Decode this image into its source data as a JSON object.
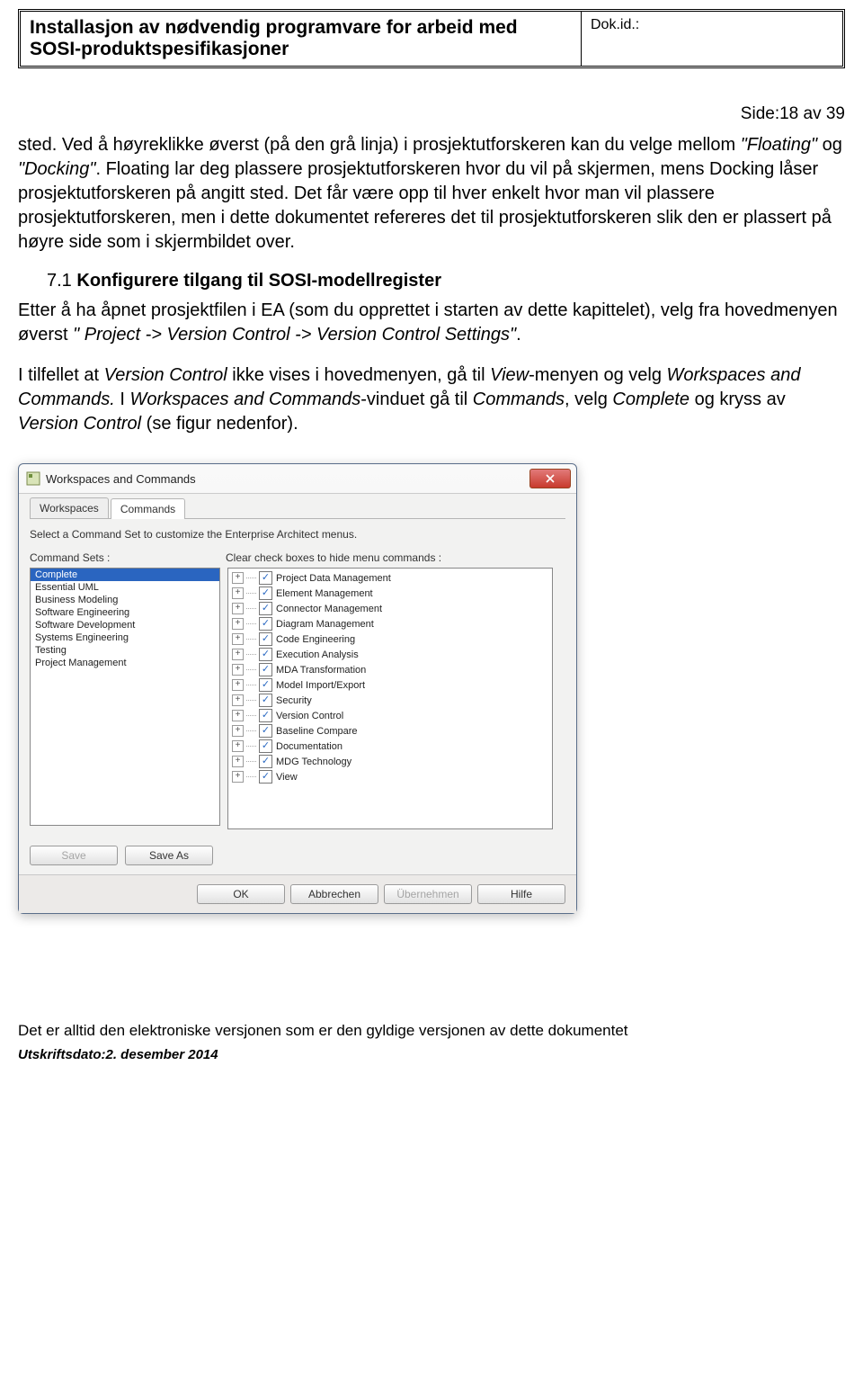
{
  "header": {
    "title": "Installasjon av nødvendig programvare for arbeid med SOSI-produktspesifikasjoner",
    "dokid_label": "Dok.id.:"
  },
  "page_number": "Side:18 av 39",
  "para1_pre": "sted. Ved å høyreklikke øverst (på den grå linja) i prosjektutforskeren kan du velge mellom ",
  "para1_q1": "\"Floating\"",
  "para1_mid": " og ",
  "para1_q2": "\"Docking\"",
  "para1_post": ". Floating lar deg plassere prosjektutforskeren hvor du vil på skjermen, mens Docking låser prosjektutforskeren på angitt sted. Det får være opp til hver enkelt hvor man vil plassere prosjektutforskeren, men i dette dokumentet refereres det til prosjektutforskeren slik den er plassert på høyre side som i skjermbildet over.",
  "section": {
    "num": "7.1",
    "title": "Konfigurere tilgang til SOSI-modellregister"
  },
  "para2_pre": "Etter å ha åpnet prosjektfilen i EA (som du opprettet i starten av dette kapittelet), velg fra hovedmenyen øverst ",
  "para2_menu": "\" Project -> Version Control -> Version Control Settings\"",
  "para2_post": ".",
  "para3_a": "I tilfellet at ",
  "para3_b": "Version Control",
  "para3_c": " ikke vises i hovedmenyen, gå til ",
  "para3_d": "View",
  "para3_e": "-menyen og velg ",
  "para3_f": "Workspaces and Commands.",
  "para3_g": " I ",
  "para3_h": "Workspaces and Commands",
  "para3_i": "-vinduet gå til ",
  "para3_j": "Commands",
  "para3_k": ", velg ",
  "para3_l": "Complete",
  "para3_m": " og kryss av ",
  "para3_n": "Version Control",
  "para3_o": " (se figur nedenfor).",
  "dialog": {
    "title": "Workspaces and Commands",
    "tab_workspaces": "Workspaces",
    "tab_commands": "Commands",
    "instruction": "Select a Command Set to customize the Enterprise Architect menus.",
    "label_sets": "Command Sets :",
    "label_clear": "Clear check boxes to hide menu commands :",
    "command_sets": [
      "Complete",
      "Essential UML",
      "Business Modeling",
      "Software Engineering",
      "Software Development",
      "Systems Engineering",
      "Testing",
      "Project Management"
    ],
    "menu_items": [
      "Project Data Management",
      "Element Management",
      "Connector Management",
      "Diagram Management",
      "Code Engineering",
      "Execution Analysis",
      "MDA Transformation",
      "Model Import/Export",
      "Security",
      "Version Control",
      "Baseline Compare",
      "Documentation",
      "MDG Technology",
      "View"
    ],
    "btn_save": "Save",
    "btn_saveas": "Save As",
    "btn_ok": "OK",
    "btn_cancel": "Abbrechen",
    "btn_apply": "Übernehmen",
    "btn_help": "Hilfe"
  },
  "footer_note": "Det er alltid den elektroniske versjonen som er den gyldige versjonen av dette dokumentet",
  "print_date": "Utskriftsdato:2. desember 2014"
}
